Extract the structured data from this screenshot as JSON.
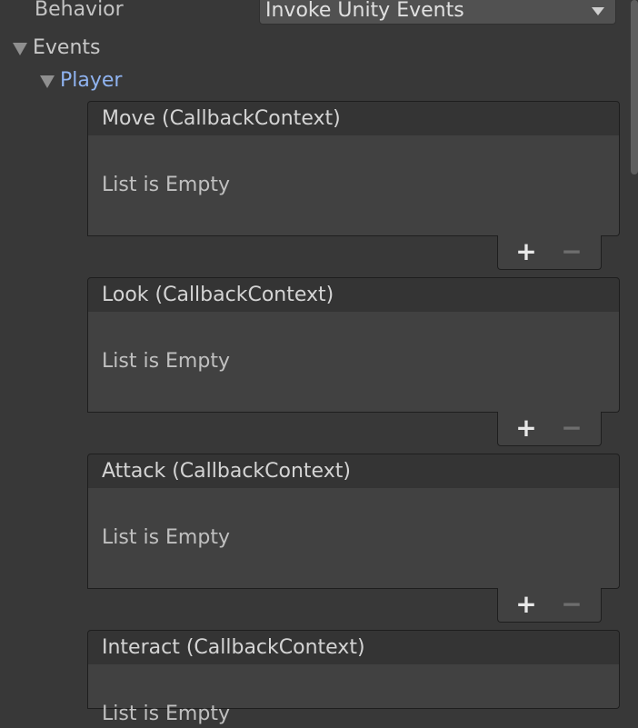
{
  "behavior": {
    "label": "Behavior",
    "selected": "Invoke Unity Events"
  },
  "events_foldout": {
    "label": "Events"
  },
  "player_foldout": {
    "label": "Player"
  },
  "events": [
    {
      "title": "Move (CallbackContext)",
      "empty_text": "List is Empty",
      "add_label": "+",
      "remove_label": "−"
    },
    {
      "title": "Look (CallbackContext)",
      "empty_text": "List is Empty",
      "add_label": "+",
      "remove_label": "−"
    },
    {
      "title": "Attack (CallbackContext)",
      "empty_text": "List is Empty",
      "add_label": "+",
      "remove_label": "−"
    },
    {
      "title": "Interact (CallbackContext)",
      "empty_text": "List is Empty",
      "add_label": "+",
      "remove_label": "−"
    }
  ]
}
